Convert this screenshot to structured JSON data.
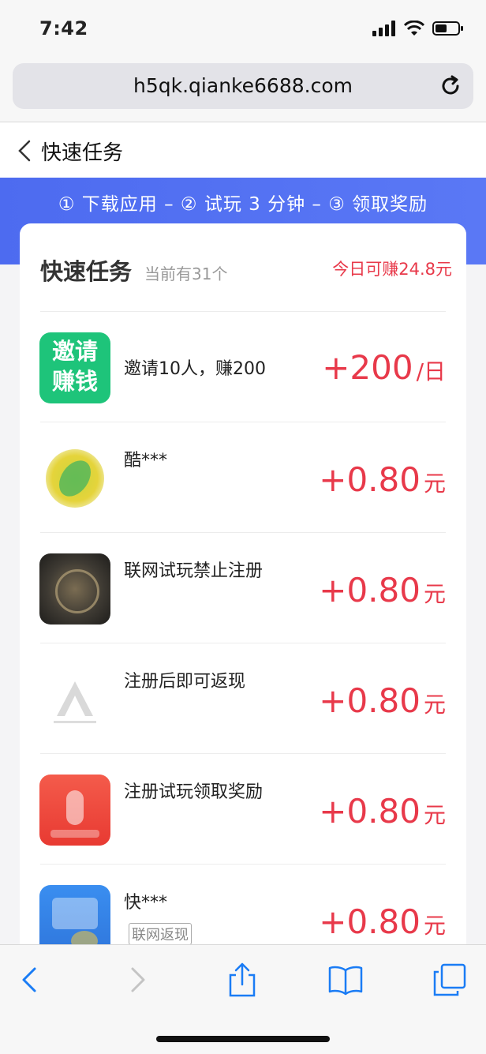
{
  "status": {
    "time": "7:42"
  },
  "browser": {
    "url": "h5qk.qianke6688.com"
  },
  "nav": {
    "title": "快速任务"
  },
  "banner": {
    "steps": "① 下载应用 – ② 试玩 3 分钟 – ③ 领取奖励"
  },
  "card": {
    "title": "快速任务",
    "count_text": "当前有31个",
    "earn_text": "今日可赚24.8元"
  },
  "tasks": [
    {
      "name": "邀请10人，赚200",
      "reward": "+200",
      "unit": "/日",
      "icon_text_1": "邀请",
      "icon_text_2": "赚钱"
    },
    {
      "name": "酷***",
      "reward": "+0.80",
      "unit": "元"
    },
    {
      "name": "联网试玩禁止注册",
      "reward": "+0.80",
      "unit": "元"
    },
    {
      "name": "注册后即可返现",
      "reward": "+0.80",
      "unit": "元"
    },
    {
      "name": "注册试玩领取奖励",
      "reward": "+0.80",
      "unit": "元"
    },
    {
      "name": "快***",
      "reward": "+0.80",
      "unit": "元",
      "tag": "联网返现"
    }
  ],
  "icons": {
    "signal": "signal-icon",
    "wifi": "wifi-icon",
    "battery": "battery-icon",
    "reload": "reload-icon",
    "back": "chevron-left-icon",
    "toolbar": [
      "back-arrow-icon",
      "forward-arrow-icon",
      "share-icon",
      "bookmarks-icon",
      "tabs-icon"
    ]
  },
  "colors": {
    "accent": "#e8394a",
    "banner": "#4d6bf0",
    "link": "#1a7cf5"
  }
}
